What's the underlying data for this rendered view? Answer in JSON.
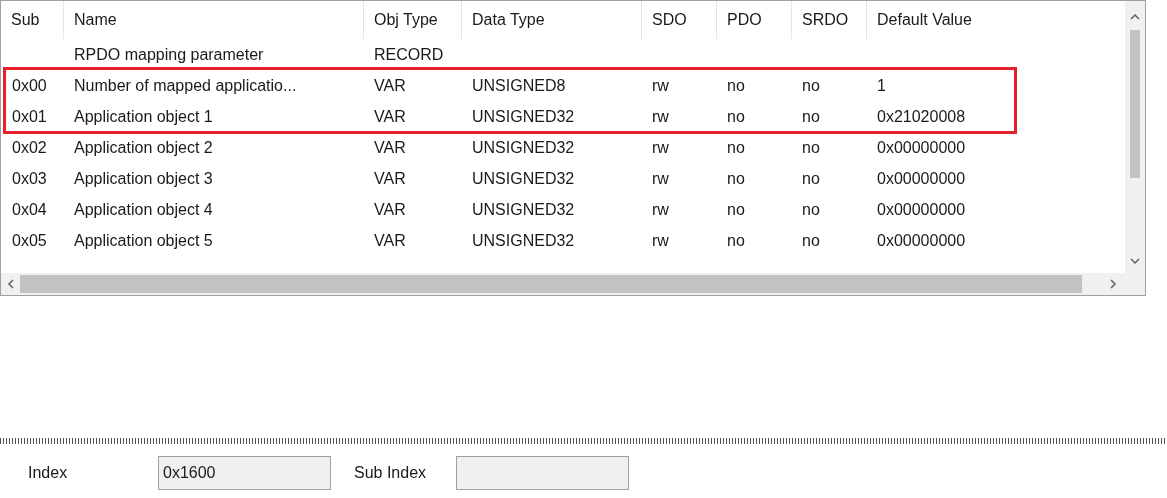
{
  "table": {
    "columns": [
      "Sub",
      "Name",
      "Obj Type",
      "Data Type",
      "SDO",
      "PDO",
      "SRDO",
      "Default Value"
    ],
    "rows": [
      {
        "cells": [
          "",
          "RPDO mapping parameter",
          "RECORD",
          "",
          "",
          "",
          "",
          ""
        ],
        "highlighted": false
      },
      {
        "cells": [
          "0x00",
          "Number of mapped applicatio...",
          "VAR",
          "UNSIGNED8",
          "rw",
          "no",
          "no",
          "1"
        ],
        "highlighted": true
      },
      {
        "cells": [
          "0x01",
          "Application object 1",
          "VAR",
          "UNSIGNED32",
          "rw",
          "no",
          "no",
          "0x21020008"
        ],
        "highlighted": true
      },
      {
        "cells": [
          "0x02",
          "Application object 2",
          "VAR",
          "UNSIGNED32",
          "rw",
          "no",
          "no",
          "0x00000000"
        ],
        "highlighted": false
      },
      {
        "cells": [
          "0x03",
          "Application object 3",
          "VAR",
          "UNSIGNED32",
          "rw",
          "no",
          "no",
          "0x00000000"
        ],
        "highlighted": false
      },
      {
        "cells": [
          "0x04",
          "Application object 4",
          "VAR",
          "UNSIGNED32",
          "rw",
          "no",
          "no",
          "0x00000000"
        ],
        "highlighted": false
      },
      {
        "cells": [
          "0x05",
          "Application object 5",
          "VAR",
          "UNSIGNED32",
          "rw",
          "no",
          "no",
          "0x00000000"
        ],
        "highlighted": false
      }
    ]
  },
  "fields": [
    {
      "label": "Index",
      "value": "0x1600"
    },
    {
      "label": "Sub Index"
    }
  ]
}
